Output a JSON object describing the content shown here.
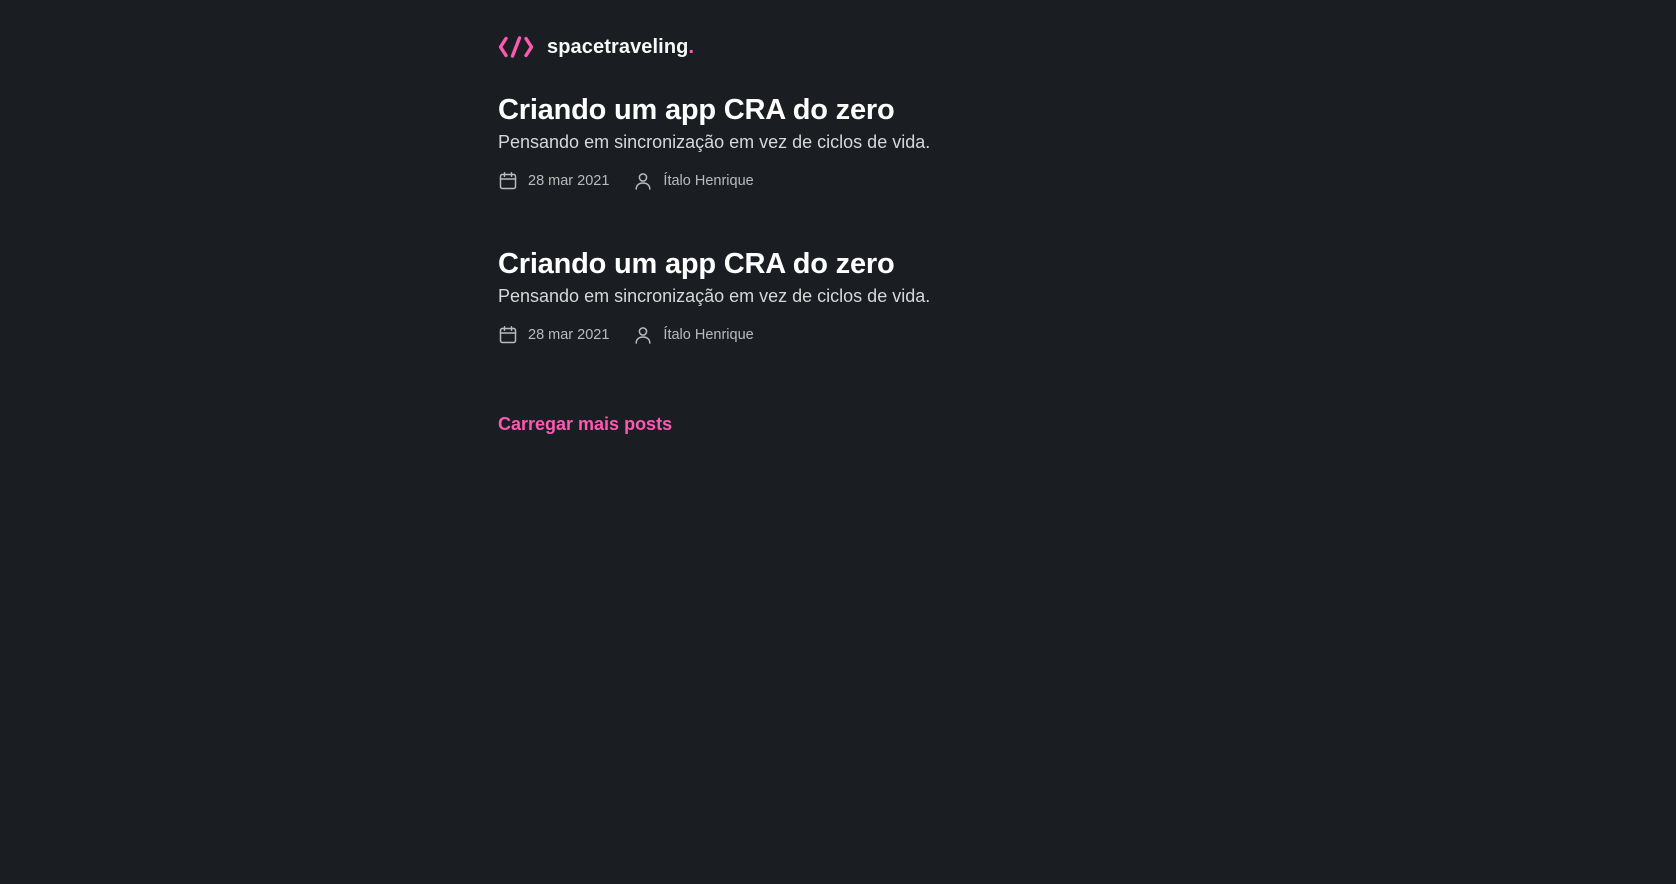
{
  "header": {
    "logo_icon": "code-brackets-icon",
    "logo_text": "spacetraveling",
    "logo_dot": "."
  },
  "posts": [
    {
      "title": "Criando um app CRA do zero",
      "subtitle": "Pensando em sincronização em vez de ciclos de vida.",
      "date": "28 mar 2021",
      "author": "Ítalo Henrique",
      "date_icon": "calendar-icon",
      "author_icon": "user-icon"
    },
    {
      "title": "Criando um app CRA do zero",
      "subtitle": "Pensando em sincronização em vez de ciclos de vida.",
      "date": "28 mar 2021",
      "author": "Ítalo Henrique",
      "date_icon": "calendar-icon",
      "author_icon": "user-icon"
    }
  ],
  "load_more_label": "Carregar mais posts",
  "colors": {
    "background": "#1a1d21",
    "accent": "#ff57b2",
    "heading": "#ffffff",
    "body_text": "#d7d7d7",
    "meta_text": "#bbbbbb"
  }
}
